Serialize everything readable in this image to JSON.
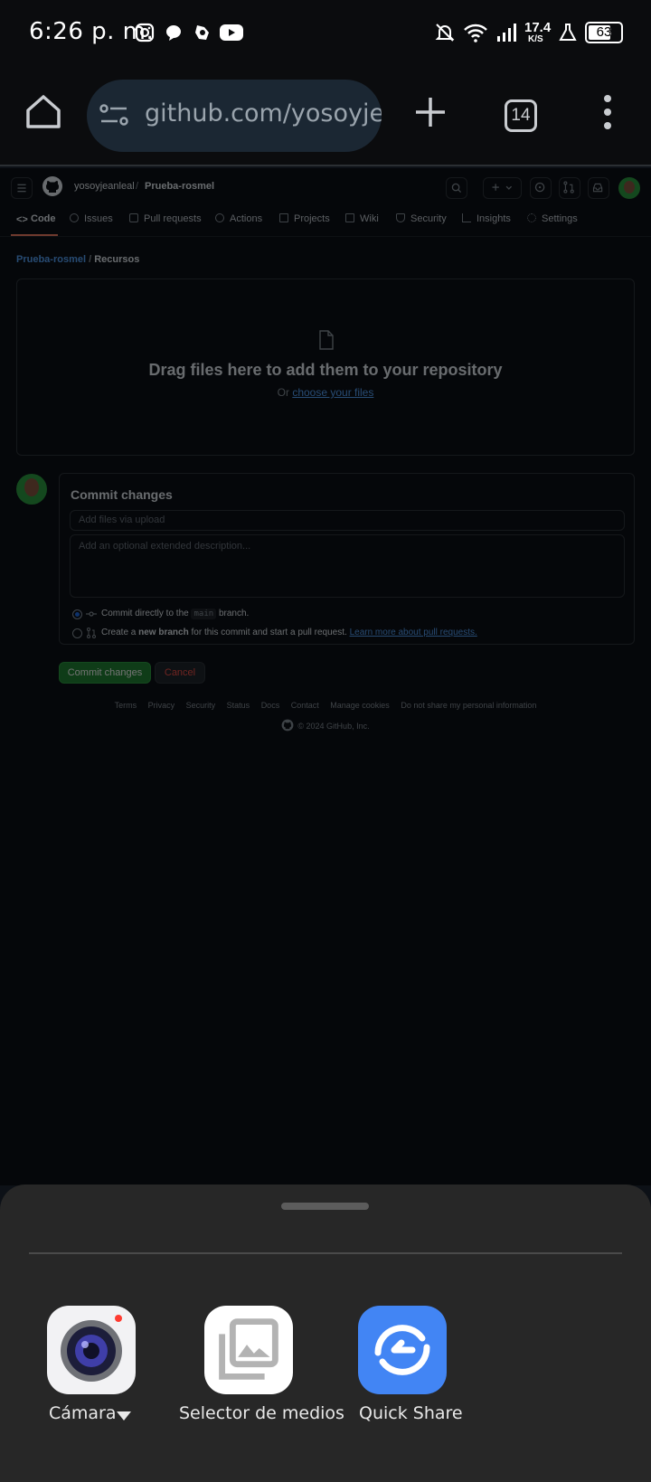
{
  "status_bar": {
    "time": "6:26 p. m.",
    "net_speed_value": "17.4",
    "net_speed_unit": "K/S",
    "battery": "63"
  },
  "browser": {
    "url": "github.com/yosoyjeanleal/Prueba-rosmel",
    "tab_count": "14"
  },
  "github": {
    "owner": "yosoyjeanleal",
    "separator": "/",
    "repo": "Prueba-rosmel",
    "tabs": [
      "Code",
      "Issues",
      "Pull requests",
      "Actions",
      "Projects",
      "Wiki",
      "Security",
      "Insights",
      "Settings"
    ],
    "breadcrumb_repo": "Prueba-rosmel",
    "breadcrumb_sep": " / ",
    "breadcrumb_folder": "Recursos",
    "drop_title": "Drag files here to add them to your repository",
    "drop_or": "Or ",
    "drop_link": "choose your files",
    "commit_title": "Commit changes",
    "summary_placeholder": "Add files via upload",
    "description_placeholder": "Add an optional extended description...",
    "radio1_prefix": "Commit directly to the",
    "radio1_branch": "main",
    "radio1_suffix": "branch.",
    "radio2_prefix": "Create a",
    "radio2_bold": "new branch",
    "radio2_mid": "for this commit and start a pull request.",
    "radio2_link": "Learn more about pull requests.",
    "commit_button": "Commit changes",
    "cancel_button": "Cancel",
    "footer_links": [
      "Terms",
      "Privacy",
      "Security",
      "Status",
      "Docs",
      "Contact",
      "Manage cookies",
      "Do not share my personal information"
    ],
    "copyright": "© 2024 GitHub, Inc."
  },
  "share_sheet": {
    "apps": [
      {
        "label": "Cámara",
        "icon": "camera-icon"
      },
      {
        "label": "Selector de medios",
        "icon": "gallery-icon"
      },
      {
        "label": "Quick Share",
        "icon": "quick-share-icon"
      }
    ]
  },
  "colors": {
    "github_bg": "#0d1117",
    "accent_tab": "#f78166",
    "commit_button": "#238636",
    "quick_share": "#4285f4",
    "sheet_bg": "#272727"
  }
}
